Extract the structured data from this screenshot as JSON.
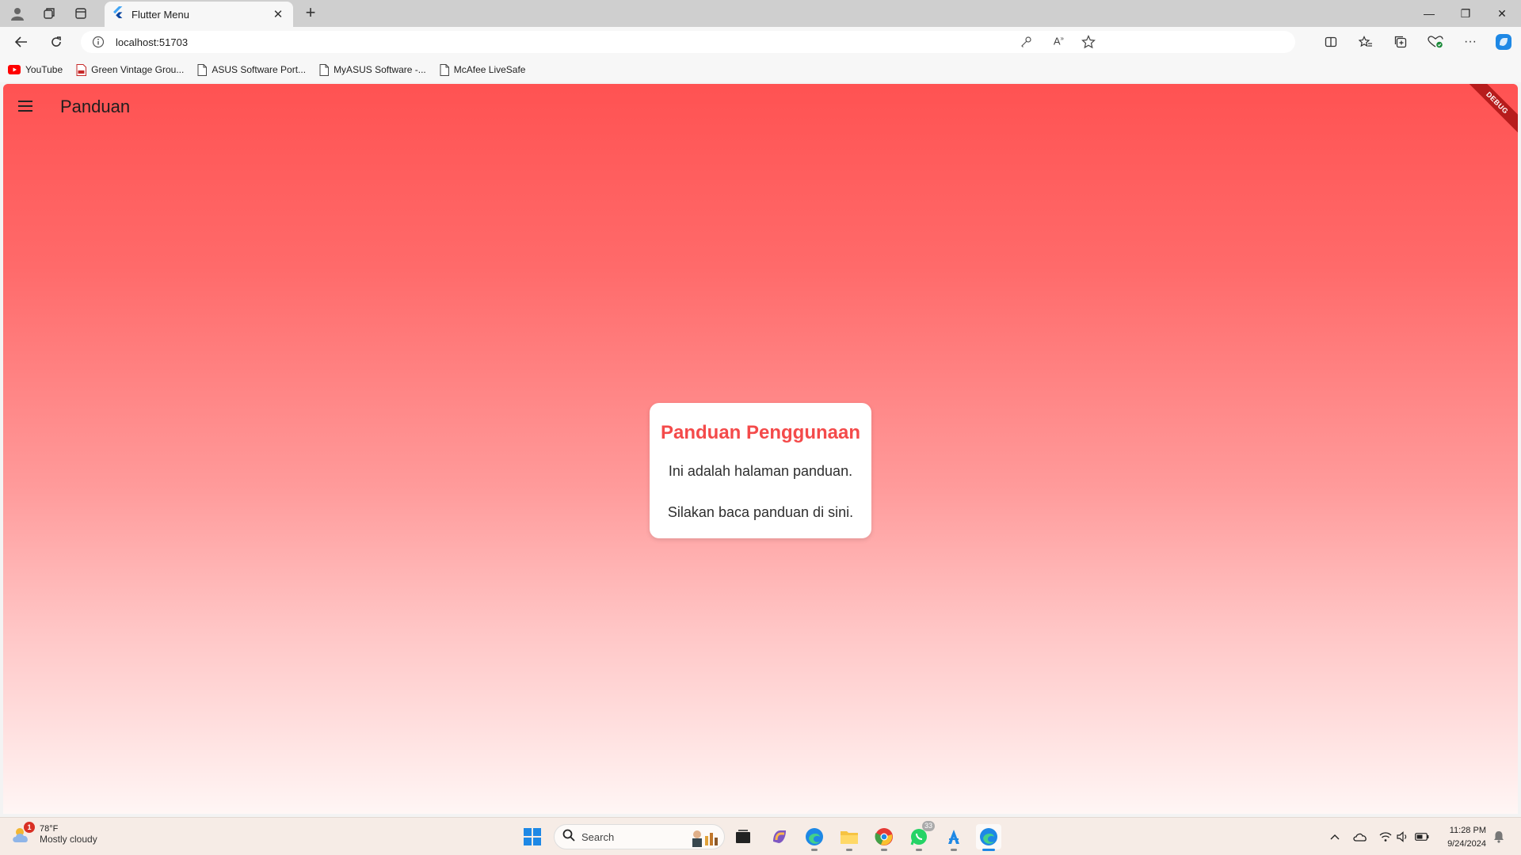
{
  "browser": {
    "tab": {
      "title": "Flutter Menu",
      "close_glyph": "✕"
    },
    "new_tab_glyph": "+",
    "address": {
      "url": "localhost:51703"
    },
    "window_controls": {
      "minimize": "—",
      "maximize": "❐",
      "close": "✕"
    },
    "bookmarks": [
      {
        "label": "YouTube",
        "icon": "youtube-icon"
      },
      {
        "label": "Green Vintage Grou...",
        "icon": "pdf-icon"
      },
      {
        "label": "ASUS Software Port...",
        "icon": "page-icon"
      },
      {
        "label": "MyASUS Software -...",
        "icon": "page-icon"
      },
      {
        "label": "McAfee LiveSafe",
        "icon": "page-icon"
      }
    ]
  },
  "app": {
    "title": "Panduan",
    "debug_banner": "DEBUG",
    "card": {
      "title": "Panduan Penggunaan",
      "line1": "Ini adalah halaman panduan.",
      "line2": "Silakan baca panduan di sini."
    },
    "colors": {
      "gradient_top": "#ff5252",
      "gradient_bottom": "#fff6f5",
      "card_title": "#f44a4a"
    }
  },
  "taskbar": {
    "weather": {
      "temp": "78°F",
      "desc": "Mostly cloudy",
      "badge": "1"
    },
    "search_placeholder": "Search",
    "whatsapp_badge": "33",
    "clock": {
      "time": "11:28 PM",
      "date": "9/24/2024"
    }
  }
}
